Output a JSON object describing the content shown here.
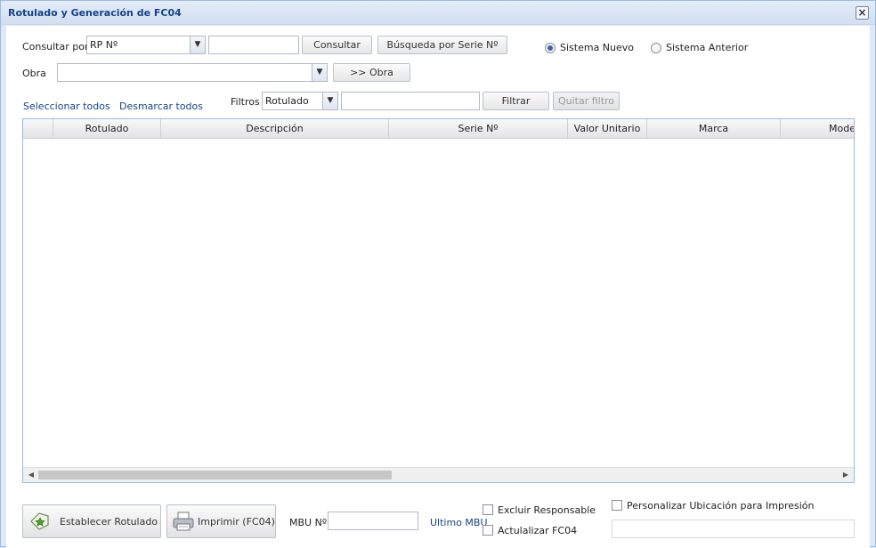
{
  "window": {
    "title": "Rotulado y Generación de FC04",
    "close_glyph": "×"
  },
  "query": {
    "consultar_por_label": "Consultar por",
    "consultar_por_value": "RP Nº",
    "query_input_value": "",
    "consultar_button": "Consultar",
    "busqueda_button": "Búsqueda por Serie Nº",
    "radio_nuevo_label": "Sistema Nuevo",
    "radio_anterior_label": "Sistema Anterior",
    "selected_system": "Sistema Nuevo",
    "obra_label": "Obra",
    "obra_value": "",
    "obra_button": ">> Obra"
  },
  "filters": {
    "select_all": "Seleccionar todos",
    "deselect_all": "Desmarcar todos",
    "filtros_label": "Filtros",
    "filtros_value": "Rotulado",
    "filter_input_value": "",
    "filtrar_button": "Filtrar",
    "quitar_button": "Quitar filtro"
  },
  "grid": {
    "columns": [
      "",
      "Rotulado",
      "Descripción",
      "Serie Nº",
      "Valor Unitario",
      "Marca",
      "Mode"
    ],
    "rows": [],
    "scroll_left_glyph": "◀",
    "scroll_right_glyph": "▶"
  },
  "footer": {
    "establecer_button": "Establecer Rotulado",
    "establecer_icon": "label-stamp-icon",
    "imprimir_button": "Imprimir (FC04)",
    "imprimir_icon": "printer-icon",
    "mbu_label": "MBU Nº",
    "mbu_value": "",
    "ultimo_mbu_link": "Ultimo MBU",
    "excluir_label": "Excluir Responsable",
    "actualizar_label": "Actulalizar FC04",
    "personalizar_label": "Personalizar Ubicación para Impresión",
    "personalizar_value": ""
  },
  "colors": {
    "title_text": "#15428b",
    "link_text": "#15428b",
    "window_border": "#99bbe8"
  }
}
